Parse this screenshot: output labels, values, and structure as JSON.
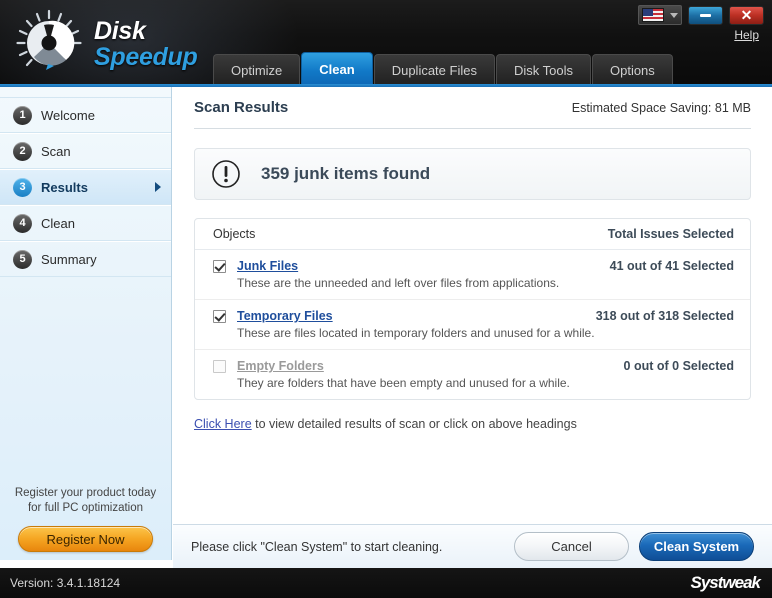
{
  "app": {
    "logo_primary": "Disk",
    "logo_secondary": "Speedup",
    "logo_icon": "gauge-dial-icon"
  },
  "titlebar": {
    "language_flag": "us-flag-icon",
    "language_caret": "chevron-down-icon",
    "minimize_glyph": "minimize-icon",
    "close_glyph": "✕",
    "help_label": "Help"
  },
  "tabs": [
    {
      "label": "Optimize",
      "active": false
    },
    {
      "label": "Clean",
      "active": true
    },
    {
      "label": "Duplicate Files",
      "active": false
    },
    {
      "label": "Disk Tools",
      "active": false
    },
    {
      "label": "Options",
      "active": false
    }
  ],
  "sidebar": {
    "items": [
      {
        "num": "1",
        "label": "Welcome",
        "active": false
      },
      {
        "num": "2",
        "label": "Scan",
        "active": false
      },
      {
        "num": "3",
        "label": "Results",
        "active": true
      },
      {
        "num": "4",
        "label": "Clean",
        "active": false
      },
      {
        "num": "5",
        "label": "Summary",
        "active": false
      }
    ],
    "register": {
      "line1": "Register your product today",
      "line2": "for full PC optimization",
      "button_label": "Register Now"
    }
  },
  "main": {
    "page_title": "Scan Results",
    "space_saving": "Estimated Space Saving:  81 MB",
    "alert": {
      "icon": "exclamation-circle-icon",
      "text": "359 junk items found"
    },
    "panel": {
      "col_objects": "Objects",
      "col_issues": "Total Issues Selected",
      "rows": [
        {
          "name": "Junk Files",
          "description": "These are the unneeded and left over files from applications.",
          "count": "41 out of 41 Selected",
          "checked": true,
          "disabled": false
        },
        {
          "name": "Temporary Files",
          "description": "These are files located in temporary folders and unused for a while.",
          "count": "318 out of 318 Selected",
          "checked": true,
          "disabled": false
        },
        {
          "name": "Empty Folders",
          "description": "They are folders that have been empty and unused for a while.",
          "count": "0 out of 0 Selected",
          "checked": false,
          "disabled": true
        }
      ]
    },
    "detail": {
      "link": "Click Here",
      "text": " to view detailed results of scan or click on above headings"
    }
  },
  "footer": {
    "message": "Please click \"Clean System\" to start cleaning.",
    "cancel_label": "Cancel",
    "clean_label": "Clean System"
  },
  "statusbar": {
    "version": "Version: 3.4.1.18124",
    "brand": "Systweak"
  },
  "colors": {
    "accent_blue": "#1179c7",
    "tab_active": "#2f9fe0",
    "link_blue": "#1f4e9c",
    "register_orange": "#f5a623",
    "close_red": "#bb2f23"
  }
}
